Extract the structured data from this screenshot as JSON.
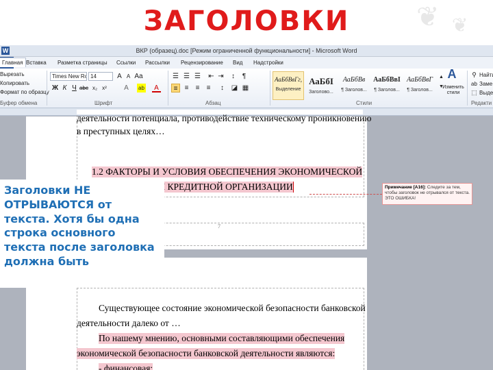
{
  "slide": {
    "title": "ЗАГОЛОВКИ"
  },
  "window": {
    "title": "ВКР (образец).doc [Режим ограниченной функциональности] - Microsoft Word",
    "app_icon": "W"
  },
  "ribbon_tabs": [
    {
      "label": "Главная"
    },
    {
      "label": "Вставка"
    },
    {
      "label": "Разметка страницы"
    },
    {
      "label": "Ссылки"
    },
    {
      "label": "Рассылки"
    },
    {
      "label": "Рецензирование"
    },
    {
      "label": "Вид"
    },
    {
      "label": "Надстройки"
    }
  ],
  "ribbon": {
    "clipboard": {
      "items": [
        "Вырезать",
        "Копировать",
        "Формат по образцу"
      ],
      "label": "Буфер обмена"
    },
    "font": {
      "name": "Times New Ro",
      "size": "14",
      "label": "Шрифт"
    },
    "paragraph": {
      "label": "Абзац"
    },
    "styles": {
      "tiles": [
        {
          "sample": "АаБбВвГг,",
          "name": "Выделение"
        },
        {
          "sample": "АаБбІ",
          "name": "Заголово..."
        },
        {
          "sample": "АаБбВв",
          "name": "¶ Заголов..."
        },
        {
          "sample": "АаБбВвІ",
          "name": "¶ Заголов..."
        },
        {
          "sample": "АаБбВвГ",
          "name": "¶ Заголов..."
        }
      ],
      "change_styles": "Изменить стили",
      "label": "Стили"
    },
    "editing": {
      "items": [
        "Найти",
        "Заме",
        "Выде"
      ],
      "label": "Редакти"
    }
  },
  "document": {
    "page1": {
      "lines": [
        "деятельности потенциала, противодействие техническому проникновению",
        "в преступных целях…",
        "1.2 ФАКТОРЫ И УСЛОВИЯ ОБЕСПЕЧЕНИЯ ЭКОНОМИЧЕСКОЙ",
        "БЕЗОПАСНОСТИ КРЕДИТНОЙ ОРГАНИЗАЦИИ"
      ],
      "page_number": "7"
    },
    "comment": {
      "prefix": "Примечание [А16]:",
      "text": "Следите за тем, чтобы заголовок не отрывался от текста. ЭТО ОШИБКА!"
    },
    "page2": {
      "lines": [
        "Существующее состояние экономической безопасности банковской",
        "деятельности далеко от …",
        "По нашему мнению, основными составляющими обеспечения",
        "экономической безопасности банковской деятельности являются:",
        "- финансовая;"
      ]
    }
  },
  "callout": {
    "text": "Заголовки НЕ ОТРЫВАЮТСЯ от текста. Хотя бы одна строка основного текста после заголовка должна быть"
  },
  "colors": {
    "title": "#e01b1b",
    "callout": "#1f6fb5",
    "highlight": "#f4c7cf",
    "word_blue": "#2b579a"
  }
}
